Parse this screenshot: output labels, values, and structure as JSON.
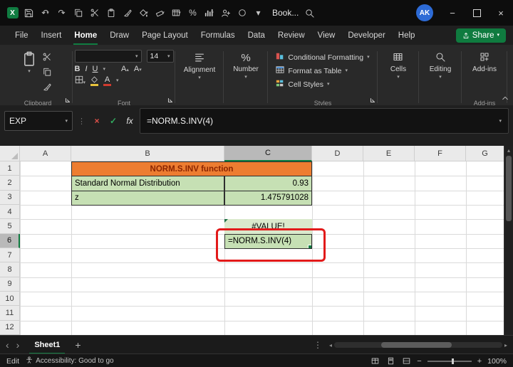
{
  "colors": {
    "accent-green": "#107C41",
    "share-green": "#0F7B3F",
    "cell-green": "#C6E0B4",
    "cell-light-green": "#DAE9CC",
    "table-orange": "#ED7D31",
    "table-title-text": "#8B2500",
    "annotation-red": "#E21A1A",
    "avatar-blue": "#2D6BD6"
  },
  "titlebar": {
    "title": "Book...",
    "avatar_initials": "AK"
  },
  "tabs": {
    "items": [
      "File",
      "Insert",
      "Home",
      "Draw",
      "Page Layout",
      "Formulas",
      "Data",
      "Review",
      "View",
      "Developer",
      "Help"
    ],
    "active": "Home",
    "share": "Share"
  },
  "ribbon": {
    "font_size": "14",
    "bold": "B",
    "italic": "I",
    "underline": "U",
    "font_letter": "A",
    "groups": {
      "clipboard": "Clipboard",
      "font": "Font",
      "styles": "Styles",
      "addins": "Add-ins"
    },
    "buttons": {
      "alignment": "Alignment",
      "number": "Number",
      "conditional_formatting": "Conditional Formatting",
      "format_as_table": "Format as Table",
      "cell_styles": "Cell Styles",
      "cells": "Cells",
      "editing": "Editing",
      "addins": "Add-ins"
    }
  },
  "formula_bar": {
    "name_box": "EXP",
    "fx": "fx",
    "formula": "=NORM.S.INV(4)"
  },
  "grid": {
    "columns": [
      "A",
      "B",
      "C",
      "D",
      "E",
      "F",
      "G"
    ],
    "rows": [
      "1",
      "2",
      "3",
      "4",
      "5",
      "6",
      "7",
      "8",
      "9",
      "10",
      "11",
      "12"
    ],
    "active_column": "C",
    "active_row": "6",
    "cells": [
      {
        "ref": "B1",
        "colspan": 2,
        "text": "NORM.S.INV function",
        "cls": "cell-title"
      },
      {
        "ref": "B2",
        "text": "Standard Normal Distribution",
        "cls": "cell-green align-left"
      },
      {
        "ref": "C2",
        "text": "0.93",
        "cls": "cell-green align-right"
      },
      {
        "ref": "B3",
        "text": "z",
        "cls": "cell-green align-left"
      },
      {
        "ref": "C3",
        "text": "1.475791028",
        "cls": "cell-green align-right"
      },
      {
        "ref": "C5",
        "text": "#VALUE!",
        "cls": "cell-light-green align-center error-corner"
      },
      {
        "ref": "C6",
        "text": "=NORM.S.INV(4)",
        "cls": "cell-green align-left editing"
      }
    ]
  },
  "sheet_bar": {
    "sheet_name": "Sheet1"
  },
  "status_bar": {
    "mode": "Edit",
    "accessibility": "Accessibility: Good to go",
    "zoom": "100%"
  }
}
